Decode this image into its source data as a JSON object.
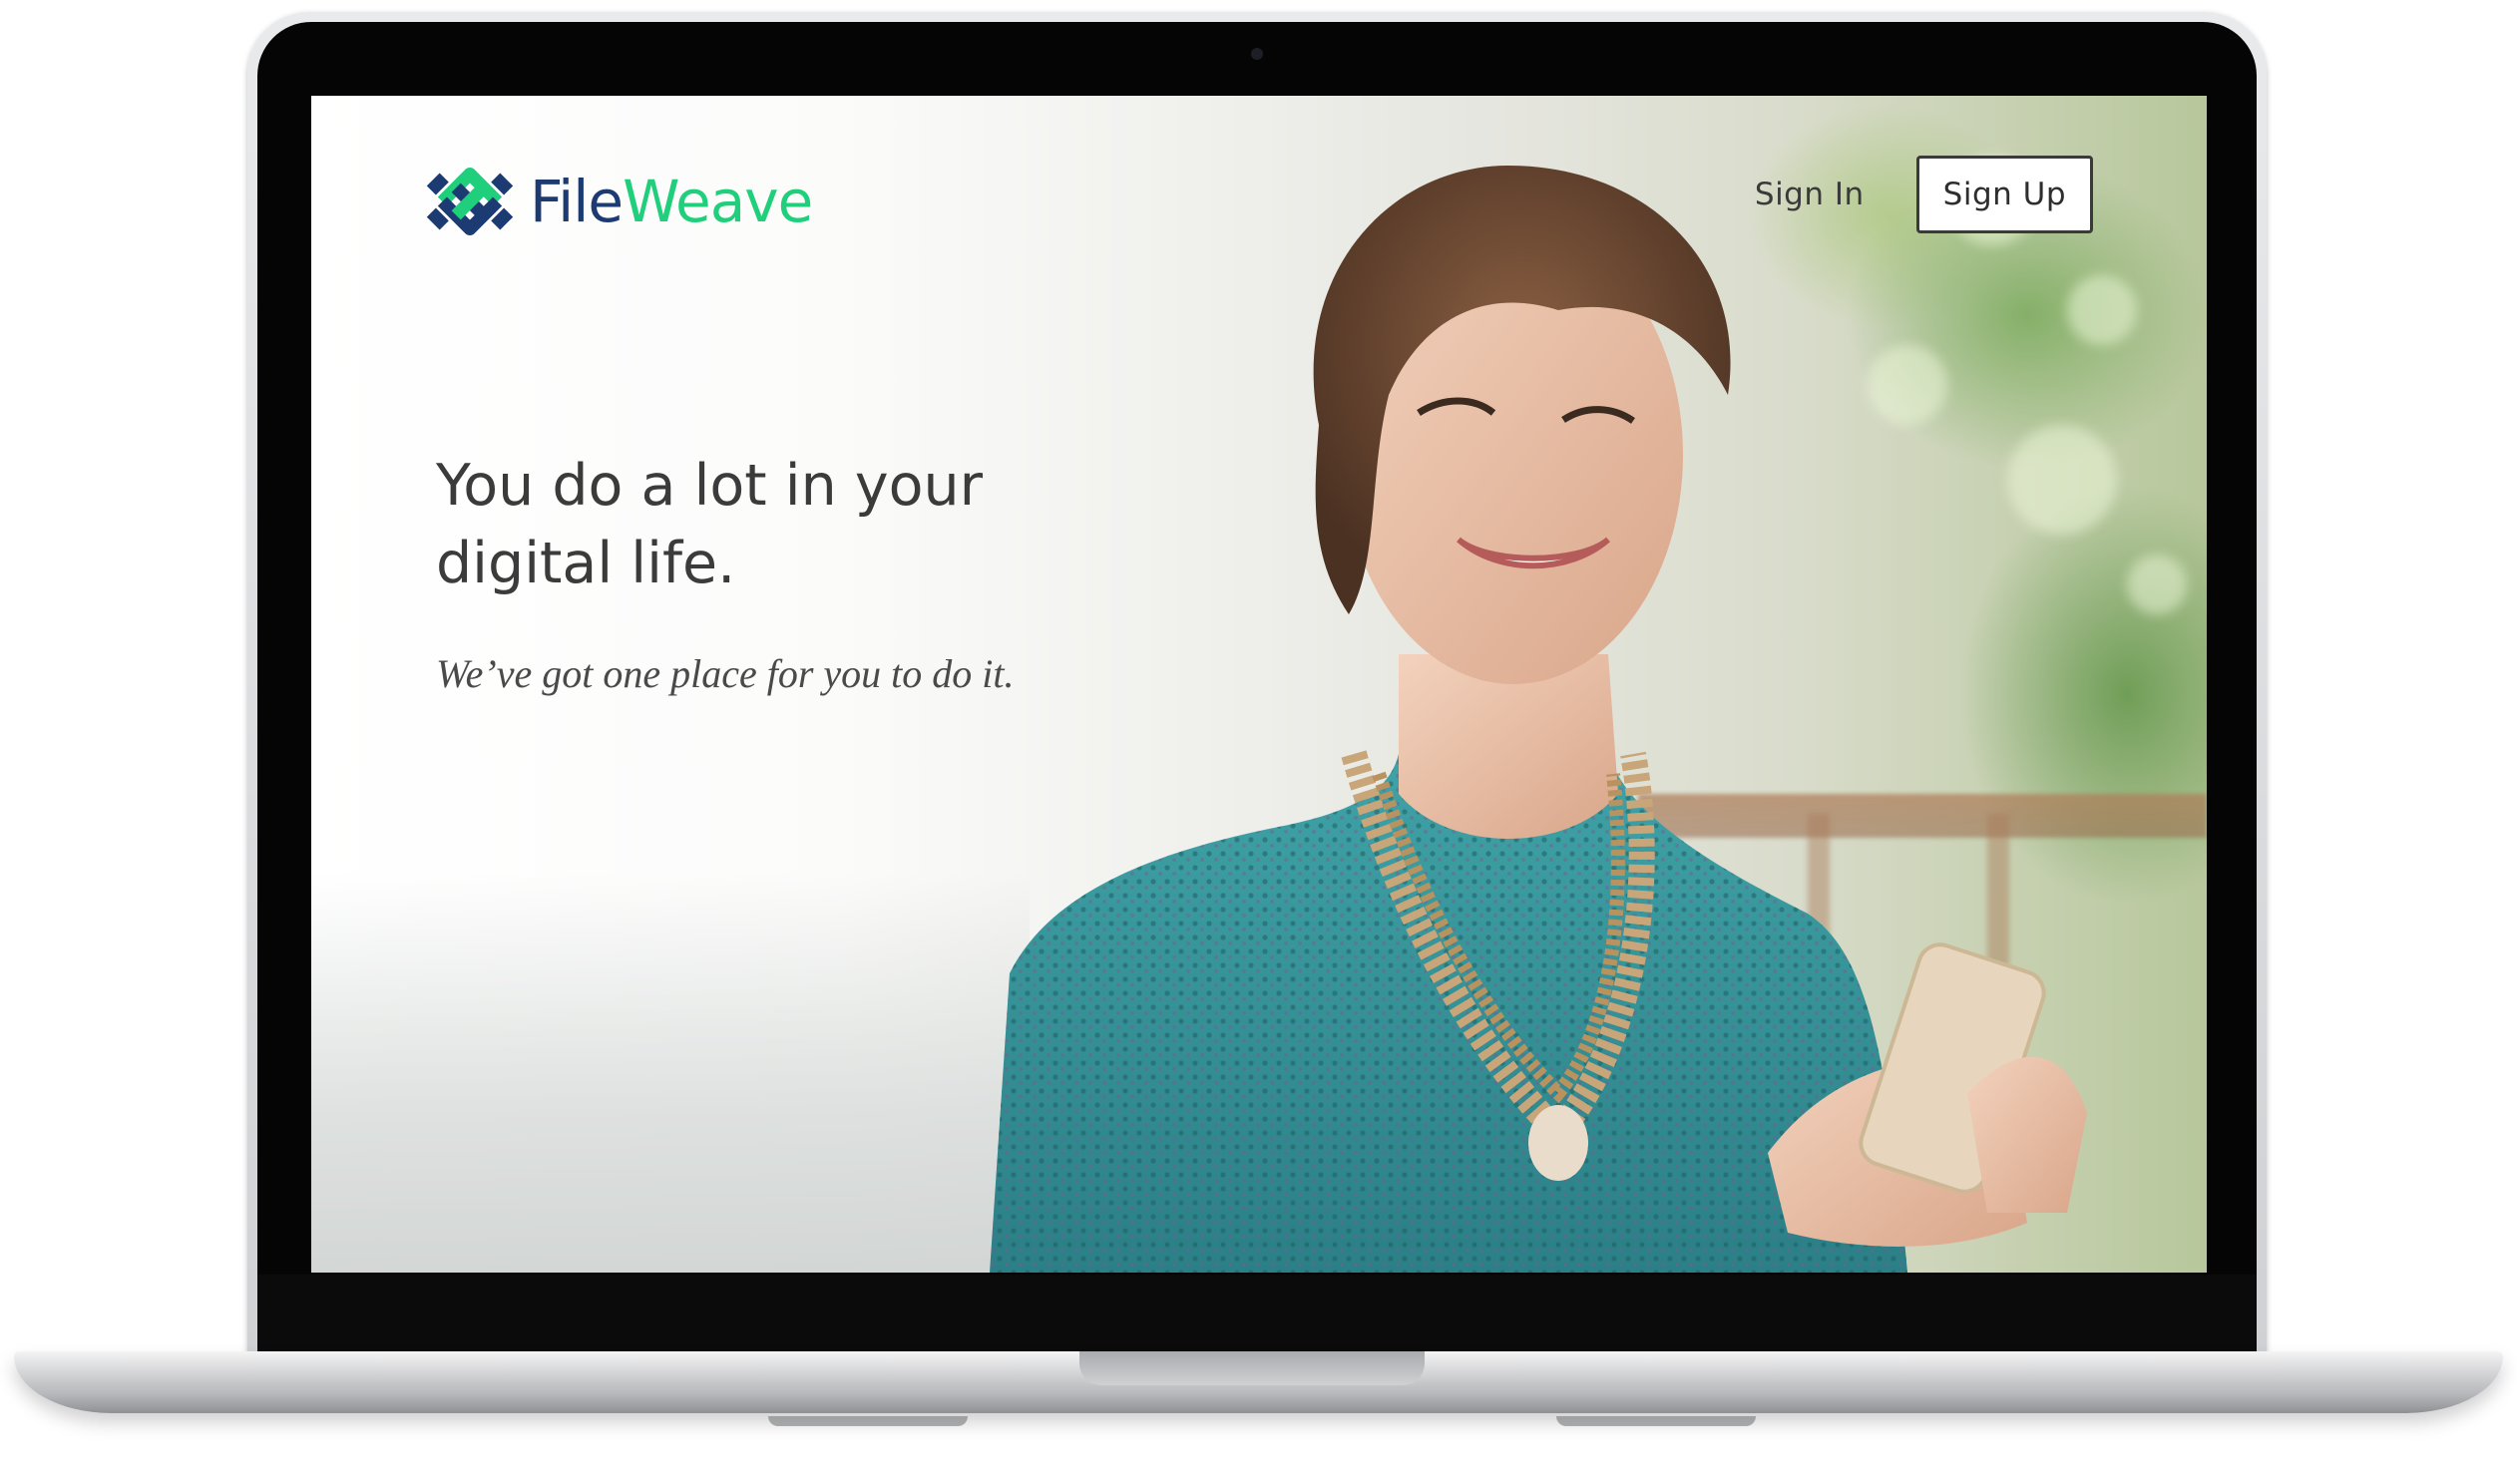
{
  "site": {
    "brand_part1": "File",
    "brand_part2": "Weave",
    "brand_colors": {
      "primary": "#1d3b73",
      "accent": "#1fcf7c"
    }
  },
  "nav": {
    "sign_in": "Sign In",
    "sign_up": "Sign Up"
  },
  "hero": {
    "headline": "You do a lot in your digital life.",
    "subline": "We’ve got one place for you to do it.",
    "image": "woman-holding-phone-photo"
  },
  "device": "laptop-mockup"
}
